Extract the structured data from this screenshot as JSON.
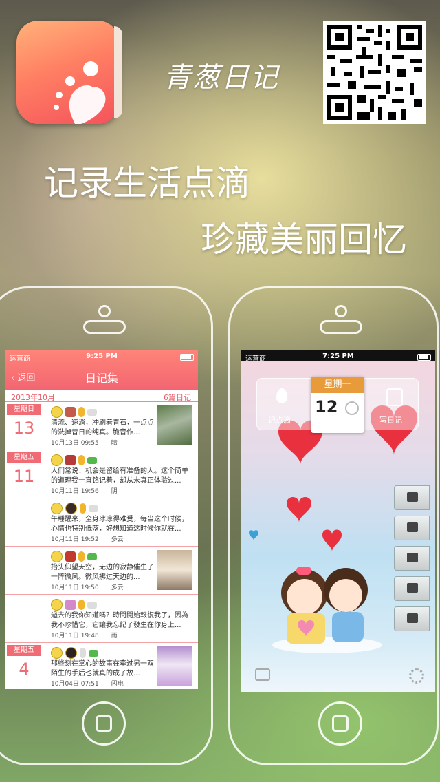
{
  "header": {
    "app_name": "青葱日记",
    "tagline_1": "记录生活点滴",
    "tagline_2": "珍藏美丽回忆"
  },
  "left_screen": {
    "status": {
      "carrier": "运营商",
      "time": "9:25 PM"
    },
    "nav": {
      "back_label": "返回",
      "title": "日记集"
    },
    "month_bar": {
      "month": "2013年10月",
      "count": "6篇日记"
    },
    "entries": [
      {
        "weekday": "星期日",
        "day": "13",
        "text": "清流、速淌，冲刷着青石，一点点的洗掉昔日的纯真。脆音作...",
        "datetime": "10月13日 09:55",
        "weather": "晴"
      },
      {
        "weekday": "星期五",
        "day": "11",
        "text": "人们常说：机会是留给有准备的人。这个简单的道理我一直铭记着，却从未真正体验过...",
        "datetime": "10月11日 19:56",
        "weather": "阴"
      },
      {
        "weekday": "",
        "day": "",
        "text": "午睡醒来，全身冰凉得难受，每当这个时候，心情也特别低落，好想知道这时候你就在...",
        "datetime": "10月11日 19:52",
        "weather": "多云"
      },
      {
        "weekday": "",
        "day": "",
        "text": "抬头仰望天空，无边的寂静催生了一阵微风。微风拂过天边的...",
        "datetime": "10月11日 19:50",
        "weather": "多云"
      },
      {
        "weekday": "",
        "day": "",
        "text": "過去的我你知道嗎？時間開始報復我了，因為我不珍惜它，它讓我忘記了發生在你身上...",
        "datetime": "10月11日 19:48",
        "weather": "雨"
      },
      {
        "weekday": "星期五",
        "day": "4",
        "text": "那些刻在掌心的故事在牵过另一双陌生的手后也就真的成了故...",
        "datetime": "10月04日 07:51",
        "weather": "闪电"
      }
    ]
  },
  "right_screen": {
    "status": {
      "carrier": "运营商",
      "time": "7:25 PM"
    },
    "widget": {
      "drop_label": "记点滴",
      "weekday": "星期一",
      "day": "12",
      "write_label": "写日记"
    }
  },
  "icons": {
    "app": "heart-dots-icon",
    "qr": "qr-code"
  },
  "colors": {
    "accent": "#f06b74",
    "nav": "#f26571",
    "calendar": "#e89b3b"
  }
}
